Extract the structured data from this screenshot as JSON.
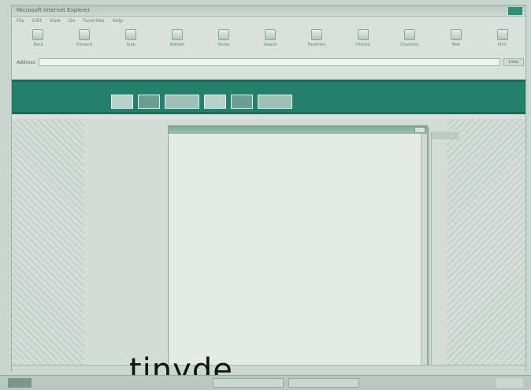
{
  "window": {
    "title": "Microsoft Internet Explorer"
  },
  "menubar": [
    "File",
    "Edit",
    "View",
    "Go",
    "Favorites",
    "Help"
  ],
  "toolbar": [
    {
      "label": "Back",
      "icon": "back-arrow-icon"
    },
    {
      "label": "Forward",
      "icon": "forward-arrow-icon"
    },
    {
      "label": "Stop",
      "icon": "stop-icon"
    },
    {
      "label": "Refresh",
      "icon": "refresh-icon"
    },
    {
      "label": "Home",
      "icon": "home-icon"
    },
    {
      "label": "Search",
      "icon": "search-icon"
    },
    {
      "label": "Favorites",
      "icon": "favorites-icon"
    },
    {
      "label": "History",
      "icon": "history-icon"
    },
    {
      "label": "Channels",
      "icon": "channels-icon"
    },
    {
      "label": "Mail",
      "icon": "mail-icon"
    },
    {
      "label": "Print",
      "icon": "print-icon"
    }
  ],
  "address": {
    "label": "Address",
    "value": "",
    "go_label": "Links"
  },
  "links": [
    "",
    "",
    "",
    "",
    ""
  ],
  "banner": {
    "logo_text": "",
    "toplinks": [
      "",
      ""
    ]
  },
  "leftnav": [
    "",
    "",
    "",
    "",
    "",
    "",
    "",
    "",
    "",
    "",
    ""
  ],
  "popup": {
    "window_title": "",
    "close_label": "",
    "heading": ""
  },
  "statusbar": {
    "left": "",
    "right": ""
  },
  "overlay_text": "tinyde",
  "taskbar": {
    "tasks": [
      "",
      ""
    ]
  }
}
